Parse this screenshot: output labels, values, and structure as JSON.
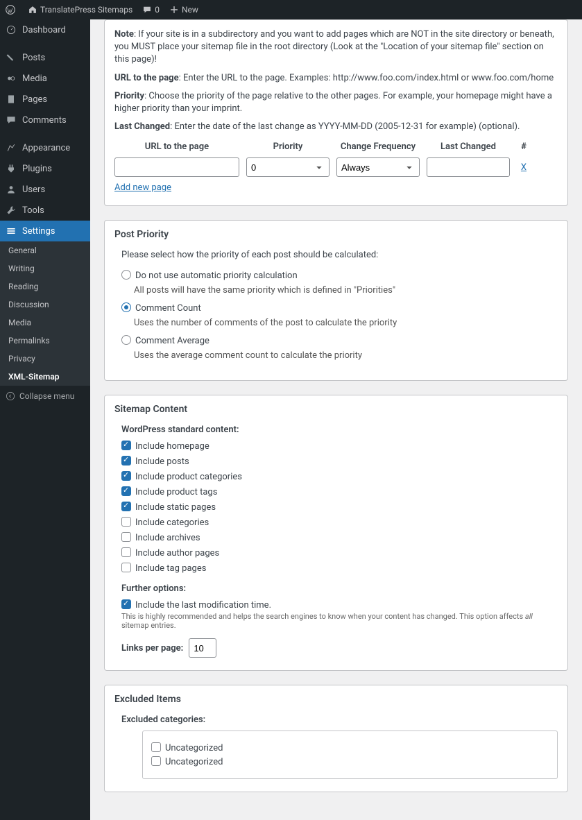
{
  "topbar": {
    "siteName": "TranslatePress Sitemaps",
    "commentCount": "0",
    "newLabel": "New"
  },
  "sidebar": {
    "items": [
      {
        "label": "Dashboard"
      },
      {
        "label": "Posts"
      },
      {
        "label": "Media"
      },
      {
        "label": "Pages"
      },
      {
        "label": "Comments"
      },
      {
        "label": "Appearance"
      },
      {
        "label": "Plugins"
      },
      {
        "label": "Users"
      },
      {
        "label": "Tools"
      },
      {
        "label": "Settings"
      }
    ],
    "subitems": [
      {
        "label": "General"
      },
      {
        "label": "Writing"
      },
      {
        "label": "Reading"
      },
      {
        "label": "Discussion"
      },
      {
        "label": "Media"
      },
      {
        "label": "Permalinks"
      },
      {
        "label": "Privacy"
      },
      {
        "label": "XML-Sitemap"
      }
    ],
    "collapse": "Collapse menu"
  },
  "helpPanel": {
    "noteLabel": "Note",
    "noteText": ": If your site is in a subdirectory and you want to add pages which are NOT in the site directory or beneath, you MUST place your sitemap file in the root directory (Look at the \"Location of your sitemap file\" section on this page)!",
    "urlLabel": "URL to the page",
    "urlText": ": Enter the URL to the page. Examples: http://www.foo.com/index.html or www.foo.com/home",
    "priorityLabel": "Priority",
    "priorityText": ": Choose the priority of the page relative to the other pages. For example, your homepage might have a higher priority than your imprint.",
    "lastChangedLabel": "Last Changed",
    "lastChangedText": ": Enter the date of the last change as YYYY-MM-DD (2005-12-31 for example) (optional).",
    "cols": {
      "url": "URL to the page",
      "priority": "Priority",
      "freq": "Change Frequency",
      "last": "Last Changed",
      "hash": "#"
    },
    "priorityValue": "0",
    "freqValue": "Always",
    "deleteX": "X",
    "addNew": "Add new page"
  },
  "postPriority": {
    "title": "Post Priority",
    "intro": "Please select how the priority of each post should be calculated:",
    "opt1": "Do not use automatic priority calculation",
    "opt1desc": "All posts will have the same priority which is defined in \"Priorities\"",
    "opt2": "Comment Count",
    "opt2desc": "Uses the number of comments of the post to calculate the priority",
    "opt3": "Comment Average",
    "opt3desc": "Uses the average comment count to calculate the priority"
  },
  "sitemapContent": {
    "title": "Sitemap Content",
    "subhead": "WordPress standard content:",
    "checks": [
      {
        "label": "Include homepage",
        "checked": true
      },
      {
        "label": "Include posts",
        "checked": true
      },
      {
        "label": "Include product categories",
        "checked": true
      },
      {
        "label": "Include product tags",
        "checked": true
      },
      {
        "label": "Include static pages",
        "checked": true
      },
      {
        "label": "Include categories",
        "checked": false
      },
      {
        "label": "Include archives",
        "checked": false
      },
      {
        "label": "Include author pages",
        "checked": false
      },
      {
        "label": "Include tag pages",
        "checked": false
      }
    ],
    "further": "Further options:",
    "modtime": "Include the last modification time.",
    "modnotePrefix": "This is highly recommended and helps the search engines to know when your content has changed. This option affects ",
    "modnoteEm": "all",
    "modnoteSuffix": " sitemap entries.",
    "linksPerPageLabel": "Links per page:",
    "linksPerPageValue": "10"
  },
  "excluded": {
    "title": "Excluded Items",
    "subhead": "Excluded categories:",
    "cats": [
      {
        "label": "Uncategorized"
      },
      {
        "label": "Uncategorized"
      }
    ]
  }
}
